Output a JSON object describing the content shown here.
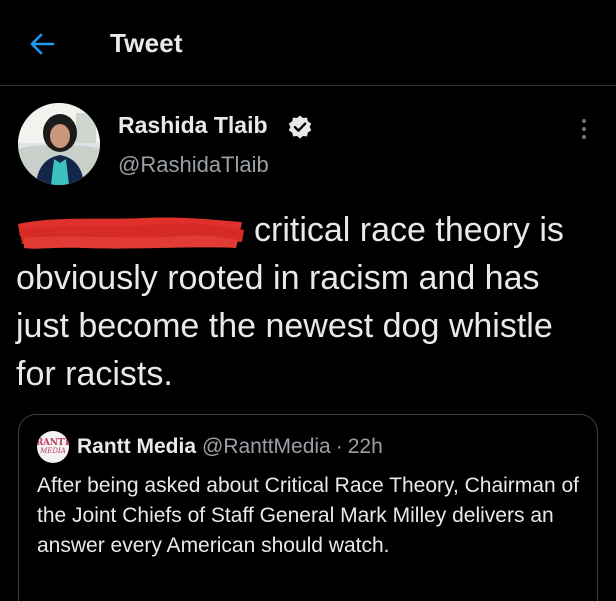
{
  "header": {
    "title": "Tweet",
    "back_icon": "arrow-left-icon",
    "accent_color": "#1d9bf0"
  },
  "author": {
    "name": "Rashida Tlaib",
    "handle": "@RashidaTlaib",
    "verified": true
  },
  "tweet": {
    "redacted_prefix": "",
    "text": "critical race theory is obviously rooted in racism and has just become the newest dog whistle for racists.",
    "redaction_color": "#e0302c"
  },
  "quoted_tweet": {
    "avatar_text_1": "RANTT",
    "avatar_text_2": "MEDIA",
    "name": "Rantt Media",
    "handle": "@RanttMedia",
    "separator": "·",
    "time": "22h",
    "text": "After being asked about Critical Race Theory, Chairman of the Joint Chiefs of Staff General Mark Milley delivers an answer every American should watch."
  }
}
